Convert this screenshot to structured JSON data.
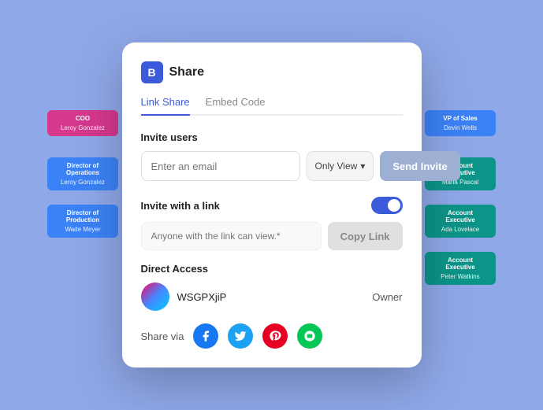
{
  "modal": {
    "icon_label": "B",
    "title": "Share",
    "tabs": [
      {
        "label": "Link Share",
        "active": true
      },
      {
        "label": "Embed Code",
        "active": false
      }
    ],
    "invite_section": {
      "label": "Invite users",
      "email_placeholder": "Enter an email",
      "permission_label": "Only View",
      "send_button": "Send Invite"
    },
    "link_section": {
      "label": "Invite with a link",
      "link_placeholder": "Anyone with the link can view.*",
      "copy_button": "Copy Link",
      "toggle_on": true
    },
    "direct_access": {
      "label": "Direct Access",
      "user": {
        "initials": "WSGPXjiP",
        "role": "Owner"
      }
    },
    "share_via": {
      "label": "Share via",
      "platforms": [
        {
          "name": "Facebook",
          "icon": "f",
          "color": "#1877f2"
        },
        {
          "name": "Twitter",
          "icon": "t",
          "color": "#1da1f2"
        },
        {
          "name": "Pinterest",
          "icon": "p",
          "color": "#e60023"
        },
        {
          "name": "Line",
          "icon": "L",
          "color": "#06c755"
        }
      ]
    }
  },
  "background": {
    "nodes": [
      {
        "title": "COO",
        "name": "Leroy Gonzalez",
        "color": "#d6388e"
      },
      {
        "title": "Director of Operations",
        "name": "Leroy Gonzalez",
        "color": "#3b82f6"
      },
      {
        "title": "Director of Production",
        "name": "Wade Meyer",
        "color": "#3b82f6"
      },
      {
        "title": "VP of Sales",
        "name": "Devin Wells",
        "color": "#3b82f6"
      },
      {
        "title": "Account Executive",
        "name": "Maria Pascal",
        "color": "#0d9488"
      },
      {
        "title": "Account Executive",
        "name": "Ada Lovelace",
        "color": "#0d9488"
      },
      {
        "title": "Account Executive",
        "name": "Peter Watkins",
        "color": "#0d9488"
      }
    ]
  }
}
